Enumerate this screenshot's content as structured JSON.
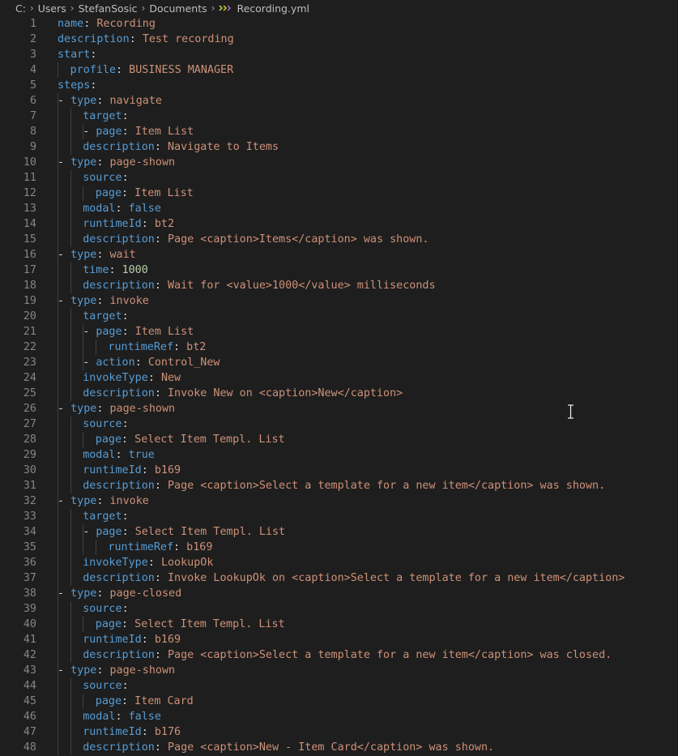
{
  "breadcrumb": {
    "segments": [
      "C:",
      "Users",
      "StefanSosic",
      "Documents"
    ],
    "file_name": "Recording.yml",
    "file_icon": "yaml-file-icon"
  },
  "colors": {
    "background": "#1e1e1e",
    "key": "#569cd6",
    "string": "#ce9178",
    "number": "#b5cea8",
    "punctuation": "#d4d4d4",
    "line_number": "#858585"
  },
  "lines": [
    {
      "num": "1",
      "indent": 0,
      "dash": false,
      "key": "name",
      "value": "Recording",
      "vtype": "s"
    },
    {
      "num": "2",
      "indent": 0,
      "dash": false,
      "key": "description",
      "value": "Test recording",
      "vtype": "s"
    },
    {
      "num": "3",
      "indent": 0,
      "dash": false,
      "key": "start",
      "value": "",
      "vtype": "s"
    },
    {
      "num": "4",
      "indent": 1,
      "dash": false,
      "key": "profile",
      "value": "BUSINESS MANAGER",
      "vtype": "s"
    },
    {
      "num": "5",
      "indent": 0,
      "dash": false,
      "key": "steps",
      "value": "",
      "vtype": "s"
    },
    {
      "num": "6",
      "indent": 1,
      "dash": true,
      "key": "type",
      "value": "navigate",
      "vtype": "s"
    },
    {
      "num": "7",
      "indent": 2,
      "dash": false,
      "key": "target",
      "value": "",
      "vtype": "s"
    },
    {
      "num": "8",
      "indent": 3,
      "dash": true,
      "key": "page",
      "value": "Item List",
      "vtype": "s"
    },
    {
      "num": "9",
      "indent": 2,
      "dash": false,
      "key": "description",
      "value": "Navigate to Items",
      "vtype": "s"
    },
    {
      "num": "10",
      "indent": 1,
      "dash": true,
      "key": "type",
      "value": "page-shown",
      "vtype": "s"
    },
    {
      "num": "11",
      "indent": 2,
      "dash": false,
      "key": "source",
      "value": "",
      "vtype": "s"
    },
    {
      "num": "12",
      "indent": 3,
      "dash": false,
      "key": "page",
      "value": "Item List",
      "vtype": "s"
    },
    {
      "num": "13",
      "indent": 2,
      "dash": false,
      "key": "modal",
      "value": "false",
      "vtype": "k"
    },
    {
      "num": "14",
      "indent": 2,
      "dash": false,
      "key": "runtimeId",
      "value": "bt2",
      "vtype": "s"
    },
    {
      "num": "15",
      "indent": 2,
      "dash": false,
      "key": "description",
      "value": "Page <caption>Items</caption> was shown.",
      "vtype": "s"
    },
    {
      "num": "16",
      "indent": 1,
      "dash": true,
      "key": "type",
      "value": "wait",
      "vtype": "s"
    },
    {
      "num": "17",
      "indent": 2,
      "dash": false,
      "key": "time",
      "value": "1000",
      "vtype": "n"
    },
    {
      "num": "18",
      "indent": 2,
      "dash": false,
      "key": "description",
      "value": "Wait for <value>1000</value> milliseconds",
      "vtype": "s"
    },
    {
      "num": "19",
      "indent": 1,
      "dash": true,
      "key": "type",
      "value": "invoke",
      "vtype": "s"
    },
    {
      "num": "20",
      "indent": 2,
      "dash": false,
      "key": "target",
      "value": "",
      "vtype": "s"
    },
    {
      "num": "21",
      "indent": 3,
      "dash": true,
      "key": "page",
      "value": "Item List",
      "vtype": "s"
    },
    {
      "num": "22",
      "indent": 4,
      "dash": false,
      "key": "runtimeRef",
      "value": "bt2",
      "vtype": "s"
    },
    {
      "num": "23",
      "indent": 3,
      "dash": true,
      "key": "action",
      "value": "Control_New",
      "vtype": "s"
    },
    {
      "num": "24",
      "indent": 2,
      "dash": false,
      "key": "invokeType",
      "value": "New",
      "vtype": "s"
    },
    {
      "num": "25",
      "indent": 2,
      "dash": false,
      "key": "description",
      "value": "Invoke New on <caption>New</caption>",
      "vtype": "s"
    },
    {
      "num": "26",
      "indent": 1,
      "dash": true,
      "key": "type",
      "value": "page-shown",
      "vtype": "s"
    },
    {
      "num": "27",
      "indent": 2,
      "dash": false,
      "key": "source",
      "value": "",
      "vtype": "s"
    },
    {
      "num": "28",
      "indent": 3,
      "dash": false,
      "key": "page",
      "value": "Select Item Templ. List",
      "vtype": "s"
    },
    {
      "num": "29",
      "indent": 2,
      "dash": false,
      "key": "modal",
      "value": "true",
      "vtype": "k"
    },
    {
      "num": "30",
      "indent": 2,
      "dash": false,
      "key": "runtimeId",
      "value": "b169",
      "vtype": "s"
    },
    {
      "num": "31",
      "indent": 2,
      "dash": false,
      "key": "description",
      "value": "Page <caption>Select a template for a new item</caption> was shown.",
      "vtype": "s"
    },
    {
      "num": "32",
      "indent": 1,
      "dash": true,
      "key": "type",
      "value": "invoke",
      "vtype": "s"
    },
    {
      "num": "33",
      "indent": 2,
      "dash": false,
      "key": "target",
      "value": "",
      "vtype": "s"
    },
    {
      "num": "34",
      "indent": 3,
      "dash": true,
      "key": "page",
      "value": "Select Item Templ. List",
      "vtype": "s"
    },
    {
      "num": "35",
      "indent": 4,
      "dash": false,
      "key": "runtimeRef",
      "value": "b169",
      "vtype": "s"
    },
    {
      "num": "36",
      "indent": 2,
      "dash": false,
      "key": "invokeType",
      "value": "LookupOk",
      "vtype": "s"
    },
    {
      "num": "37",
      "indent": 2,
      "dash": false,
      "key": "description",
      "value": "Invoke LookupOk on <caption>Select a template for a new item</caption>",
      "vtype": "s"
    },
    {
      "num": "38",
      "indent": 1,
      "dash": true,
      "key": "type",
      "value": "page-closed",
      "vtype": "s"
    },
    {
      "num": "39",
      "indent": 2,
      "dash": false,
      "key": "source",
      "value": "",
      "vtype": "s"
    },
    {
      "num": "40",
      "indent": 3,
      "dash": false,
      "key": "page",
      "value": "Select Item Templ. List",
      "vtype": "s"
    },
    {
      "num": "41",
      "indent": 2,
      "dash": false,
      "key": "runtimeId",
      "value": "b169",
      "vtype": "s"
    },
    {
      "num": "42",
      "indent": 2,
      "dash": false,
      "key": "description",
      "value": "Page <caption>Select a template for a new item</caption> was closed.",
      "vtype": "s"
    },
    {
      "num": "43",
      "indent": 1,
      "dash": true,
      "key": "type",
      "value": "page-shown",
      "vtype": "s"
    },
    {
      "num": "44",
      "indent": 2,
      "dash": false,
      "key": "source",
      "value": "",
      "vtype": "s"
    },
    {
      "num": "45",
      "indent": 3,
      "dash": false,
      "key": "page",
      "value": "Item Card",
      "vtype": "s"
    },
    {
      "num": "46",
      "indent": 2,
      "dash": false,
      "key": "modal",
      "value": "false",
      "vtype": "k"
    },
    {
      "num": "47",
      "indent": 2,
      "dash": false,
      "key": "runtimeId",
      "value": "b176",
      "vtype": "s"
    },
    {
      "num": "48",
      "indent": 2,
      "dash": false,
      "key": "description",
      "value": "Page <caption>New - Item Card</caption> was shown.",
      "vtype": "s"
    }
  ]
}
